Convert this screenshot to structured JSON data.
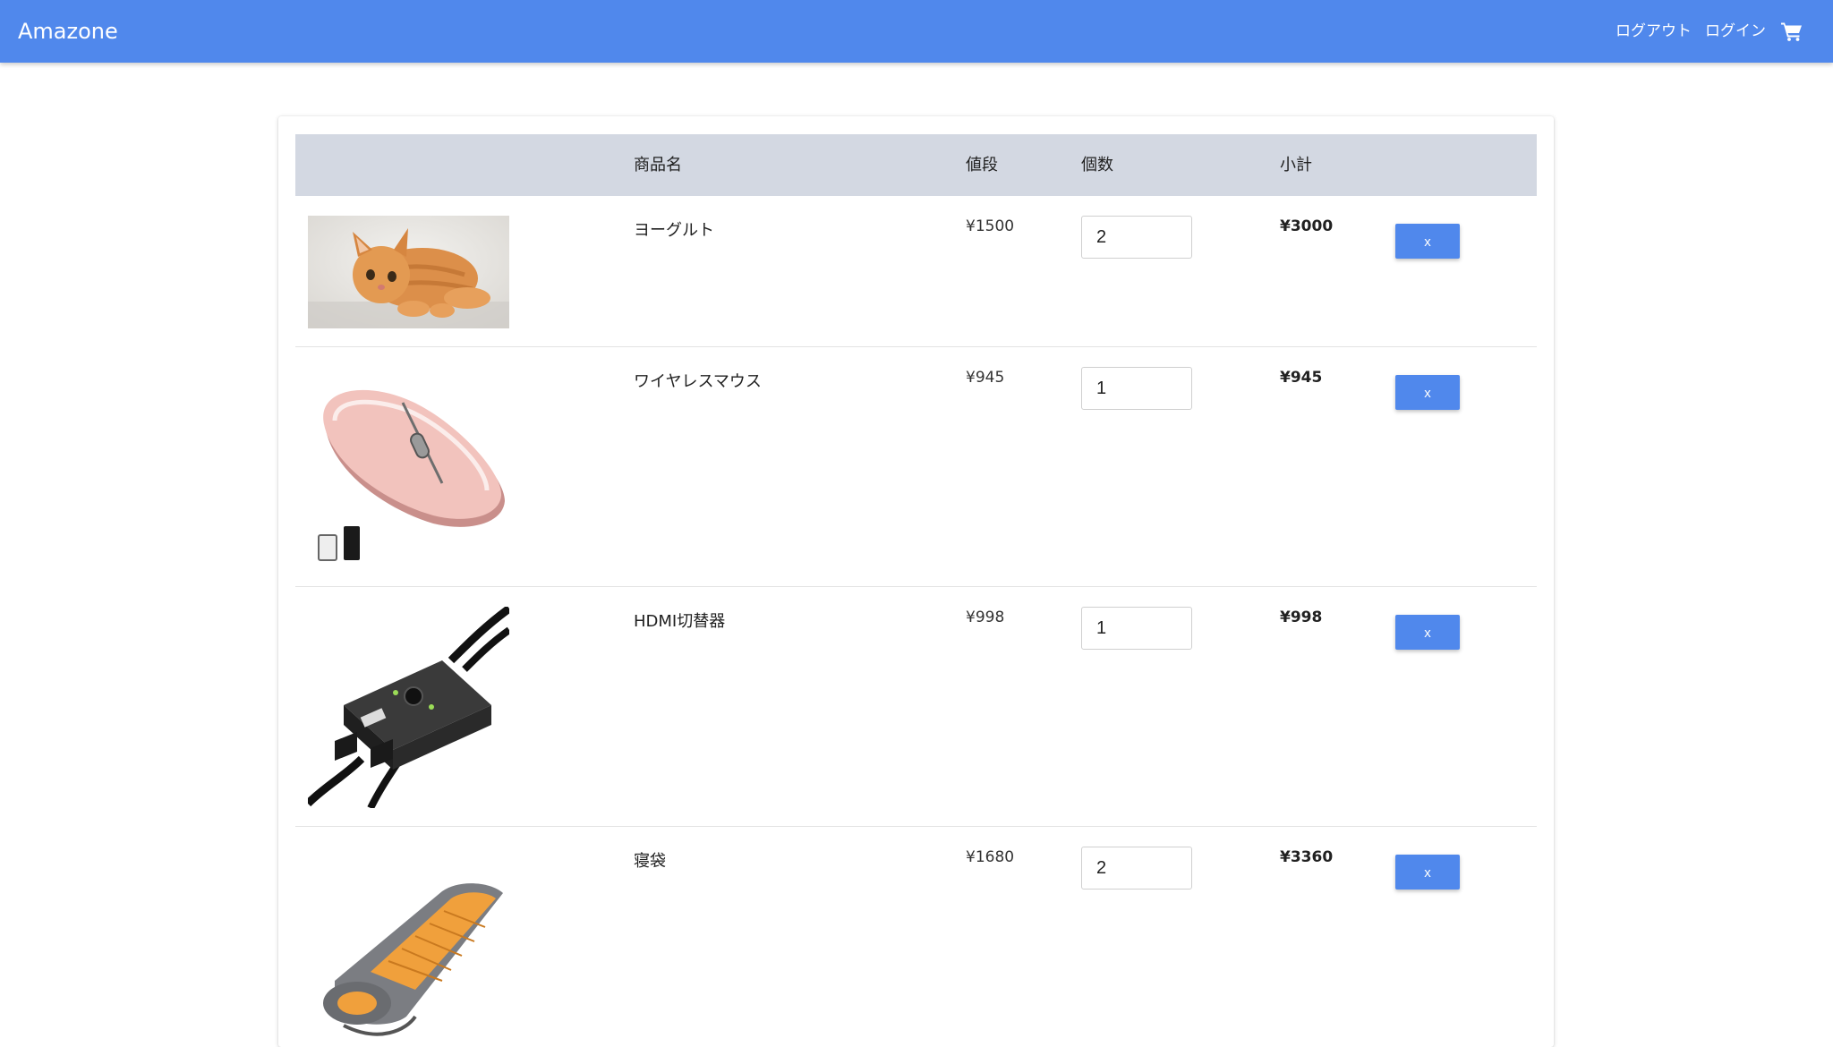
{
  "header": {
    "brand": "Amazone",
    "logout_label": "ログアウト",
    "login_label": "ログイン",
    "cart_icon": "shopping-cart-icon",
    "bg_color": "#5088ec"
  },
  "cart": {
    "columns": {
      "image": "",
      "name": "商品名",
      "price": "値段",
      "quantity": "個数",
      "subtotal": "小計",
      "actions": ""
    },
    "items": [
      {
        "name": "ヨーグルト",
        "price": "¥1500",
        "quantity": "2",
        "subtotal": "¥3000",
        "delete_label": "x",
        "image": "orange-kitten-photo"
      },
      {
        "name": "ワイヤレスマウス",
        "price": "¥945",
        "quantity": "1",
        "subtotal": "¥945",
        "delete_label": "x",
        "image": "pink-wireless-mouse-photo"
      },
      {
        "name": "HDMI切替器",
        "price": "¥998",
        "quantity": "1",
        "subtotal": "¥998",
        "delete_label": "x",
        "image": "hdmi-switch-photo"
      },
      {
        "name": "寝袋",
        "price": "¥1680",
        "quantity": "2",
        "subtotal": "¥3360",
        "delete_label": "x",
        "image": "sleeping-bag-photo"
      }
    ]
  }
}
